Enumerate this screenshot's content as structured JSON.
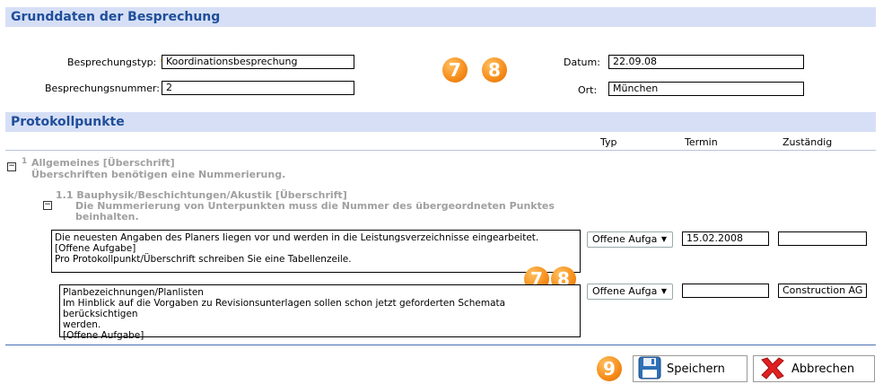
{
  "sections": {
    "basics_title": "Grunddaten der Besprechung",
    "points_title": "Protokollpunkte"
  },
  "form": {
    "type_label": "Besprechungstyp:",
    "type_value": "Koordinationsbesprechung",
    "number_label": "Besprechungsnummer:",
    "number_value": "2",
    "required_mark": "*",
    "date_label": "Datum:",
    "date_value": "22.09.08",
    "place_label": "Ort:",
    "place_value": "München"
  },
  "badges": {
    "seven": "7",
    "eight": "8",
    "nine": "9"
  },
  "columns": {
    "type": "Typ",
    "deadline": "Termin",
    "responsible": "Zuständig"
  },
  "tree": {
    "toggle_symbol": "−",
    "heading1_number": "1",
    "heading1_title": "Allgemeines [Überschrift]",
    "heading1_note": "Überschriften benötigen eine Nummerierung.",
    "heading2_title": "1.1 Bauphysik/Beschichtungen/Akustik [Überschrift]",
    "heading2_note_line1": "Die Nummerierung von Unterpunkten muss die Nummer des übergeordneten Punktes",
    "heading2_note_line2": "beinhalten."
  },
  "rows": [
    {
      "line1": "Die neuesten Angaben des Planers liegen vor und werden in die Leistungsverzeichnisse eingearbeitet.",
      "line2": "[Offene Aufgabe]",
      "line3": "Pro Protokollpunkt/Überschrift schreiben Sie eine Tabellenzeile.",
      "type": "Offene Aufga",
      "deadline": "15.02.2008",
      "responsible": ""
    },
    {
      "line1": "Planbezeichnungen/Planlisten",
      "line2": "Im Hinblick auf die Vorgaben zu Revisionsunterlagen sollen schon jetzt geforderten Schemata berücksichtigen",
      "line3": "werden.",
      "line4": "[Offene Aufgabe]",
      "type": "Offene Aufga",
      "deadline": "",
      "responsible": "Construction AG"
    }
  ],
  "buttons": {
    "save": "Speichern",
    "cancel": "Abbrechen"
  },
  "colors": {
    "header_bg": "#d6dff5",
    "header_text": "#1f4e9a",
    "badge": "#f7901e",
    "required": "#f0a020"
  }
}
